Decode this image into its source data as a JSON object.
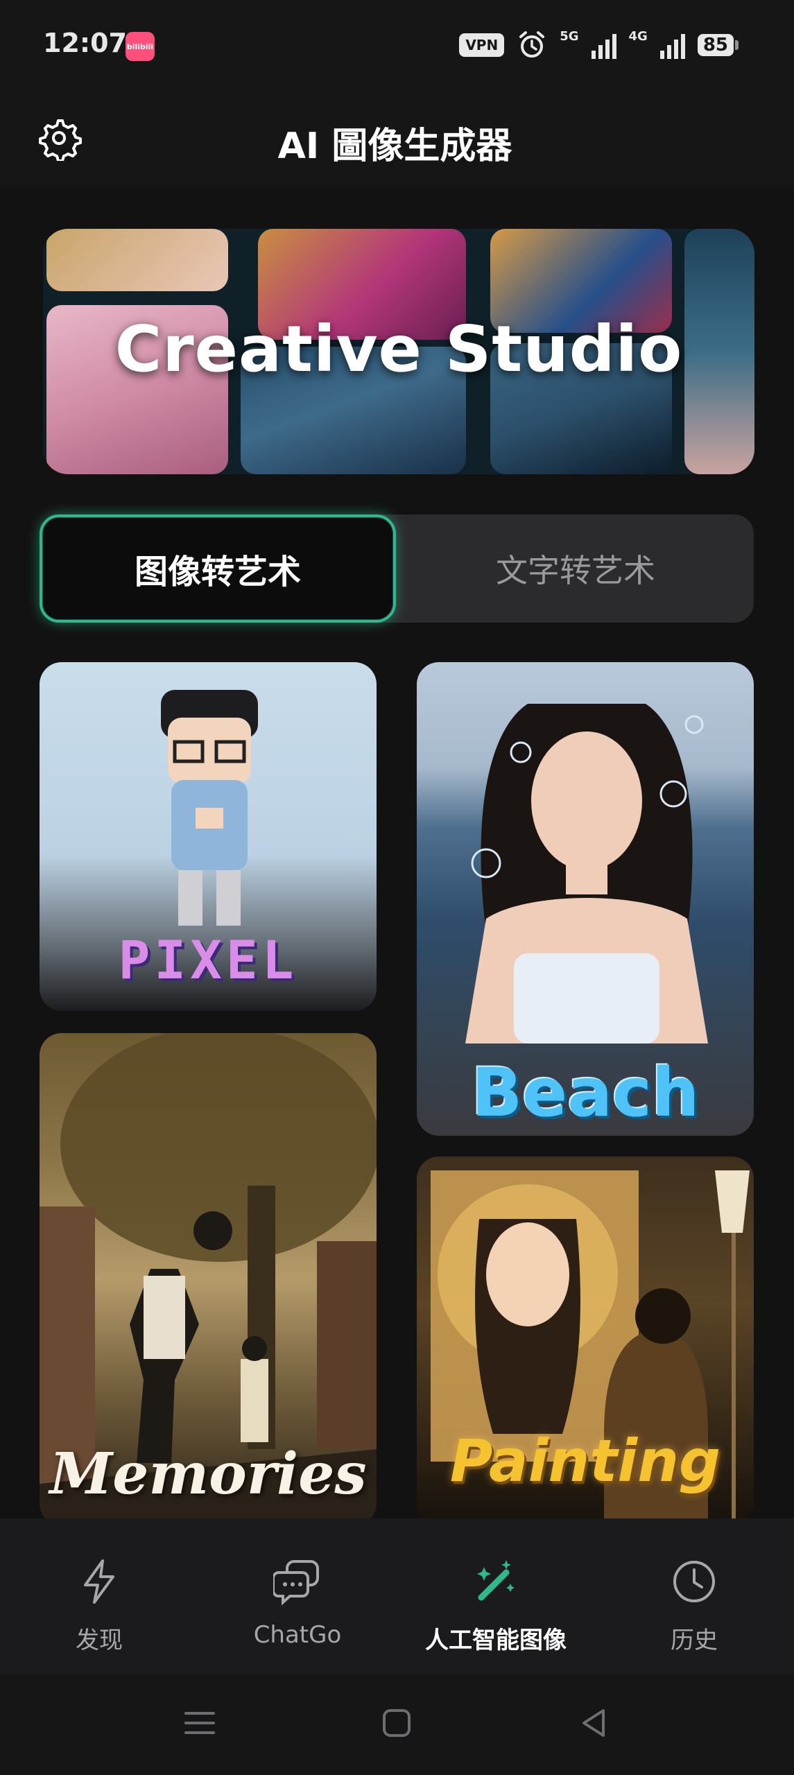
{
  "status_bar": {
    "time": "12:07",
    "app_icon_text": "bilibili",
    "vpn": "VPN",
    "net1": "5G",
    "net2": "4G",
    "battery": "85"
  },
  "header": {
    "title": "AI 圖像生成器",
    "settings_icon": "gear-icon"
  },
  "banner": {
    "title": "Creative Studio"
  },
  "tabs": [
    {
      "label": "图像转艺术",
      "active": true
    },
    {
      "label": "文字转艺术",
      "active": false
    }
  ],
  "cards": {
    "pixel": "PIXEL",
    "beach": "Beach",
    "memories": "Memories",
    "painting": "Painting"
  },
  "bottom_nav": [
    {
      "label": "发现",
      "icon": "lightning-icon"
    },
    {
      "label": "ChatGo",
      "icon": "chat-bubbles-icon"
    },
    {
      "label": "人工智能图像",
      "icon": "magic-wand-icon",
      "active": true
    },
    {
      "label": "历史",
      "icon": "clock-icon"
    }
  ],
  "colors": {
    "accent": "#2fb88c",
    "background": "#121212"
  }
}
